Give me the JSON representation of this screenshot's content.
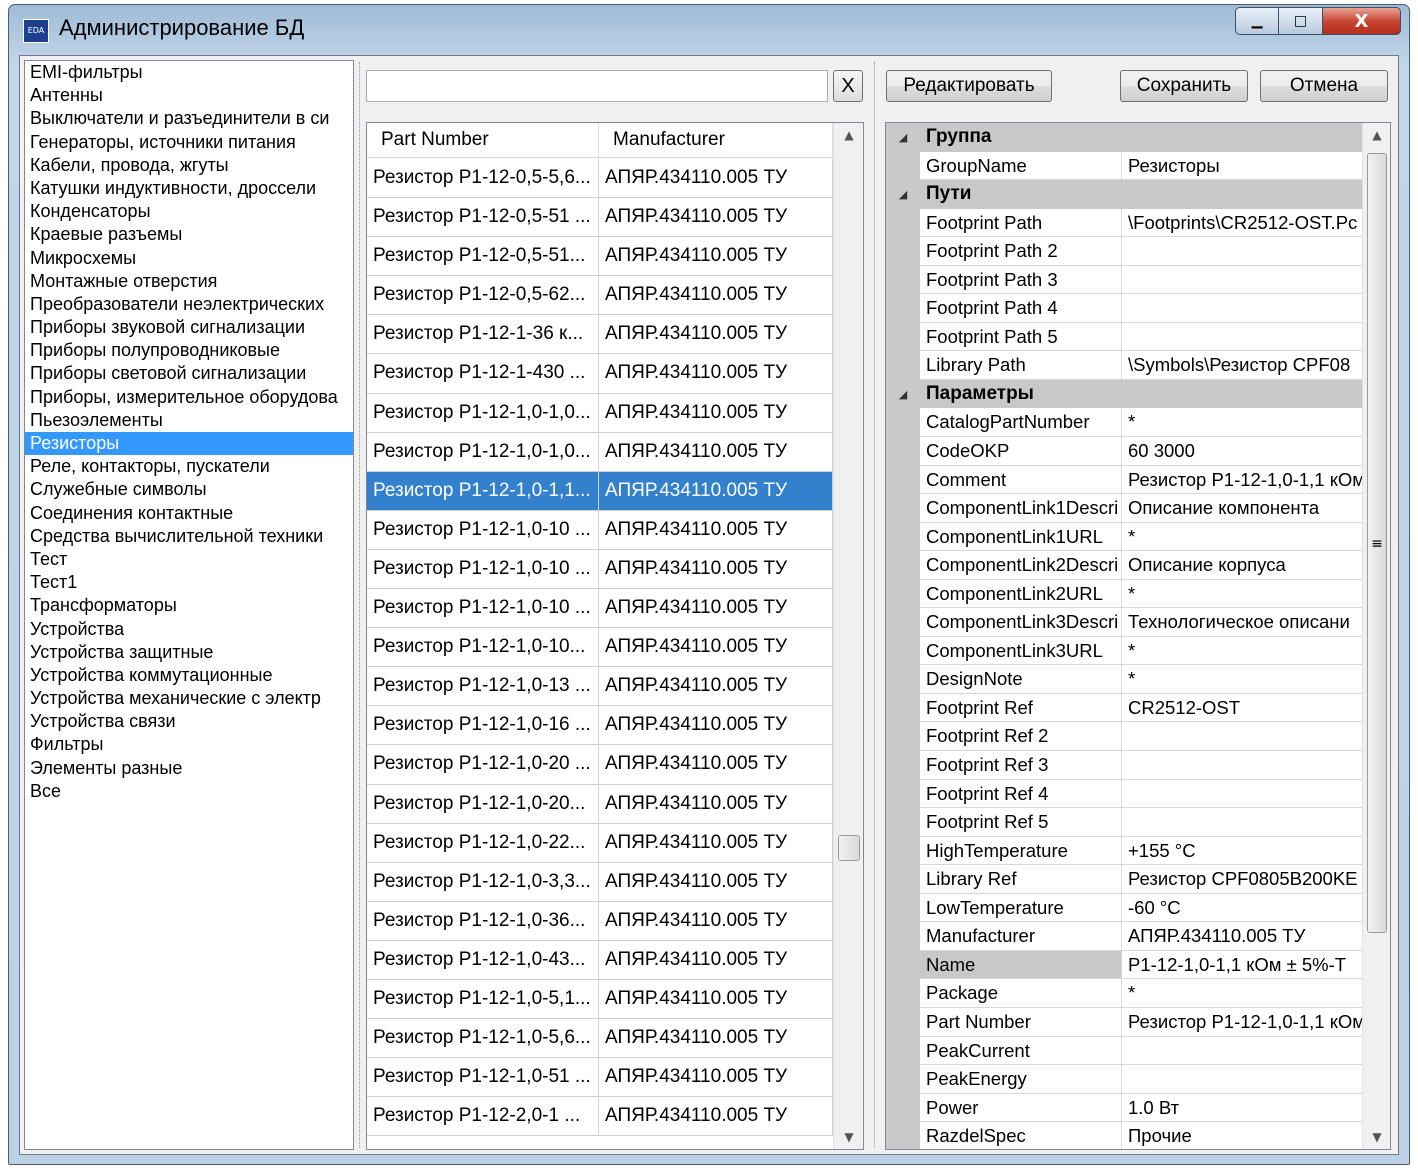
{
  "window": {
    "title": "Администрирование БД",
    "icon_label": "EDA",
    "minimize_glyph": "▁",
    "maximize_glyph": "□",
    "close_glyph": "X"
  },
  "categories": [
    "EMI-фильтры",
    "Антенны",
    "Выключатели и разъединители в си",
    "Генераторы, источники питания",
    "Кабели, провода, жгуты",
    "Катушки индуктивности, дроссели",
    "Конденсаторы",
    "Краевые разъемы",
    "Микросхемы",
    "Монтажные отверстия",
    "Преобразователи неэлектрических",
    "Приборы звуковой сигнализации",
    "Приборы полупроводниковые",
    "Приборы световой сигнализации",
    "Приборы, измерительное оборудова",
    "Пьезоэлементы",
    "Резисторы",
    "Реле, контакторы, пускатели",
    "Служебные символы",
    "Соединения контактные",
    "Средства вычислительной техники",
    "Тест",
    "Тест1",
    "Трансформаторы",
    "Устройства",
    "Устройства защитные",
    "Устройства коммутационные",
    "Устройства механические с электр",
    "Устройства связи",
    "Фильтры",
    "Элементы разные",
    "Все"
  ],
  "selected_category": "Резисторы",
  "search": {
    "value": "",
    "clear_label": "X"
  },
  "grid": {
    "columns": [
      "Part Number",
      "Manufacturer"
    ],
    "rows": [
      [
        "Резистор Р1-12-0,5-5,6...",
        "АПЯР.434110.005 ТУ"
      ],
      [
        "Резистор Р1-12-0,5-51 ...",
        "АПЯР.434110.005 ТУ"
      ],
      [
        "Резистор Р1-12-0,5-51...",
        "АПЯР.434110.005 ТУ"
      ],
      [
        "Резистор Р1-12-0,5-62...",
        "АПЯР.434110.005 ТУ"
      ],
      [
        "Резистор Р1-12-1-36 к...",
        "АПЯР.434110.005 ТУ"
      ],
      [
        "Резистор Р1-12-1-430 ...",
        "АПЯР.434110.005 ТУ"
      ],
      [
        "Резистор Р1-12-1,0-1,0...",
        "АПЯР.434110.005 ТУ"
      ],
      [
        "Резистор Р1-12-1,0-1,0...",
        "АПЯР.434110.005 ТУ"
      ],
      [
        "Резистор Р1-12-1,0-1,1...",
        "АПЯР.434110.005 ТУ"
      ],
      [
        "Резистор Р1-12-1,0-10 ...",
        "АПЯР.434110.005 ТУ"
      ],
      [
        "Резистор Р1-12-1,0-10 ...",
        "АПЯР.434110.005 ТУ"
      ],
      [
        "Резистор Р1-12-1,0-10 ...",
        "АПЯР.434110.005 ТУ"
      ],
      [
        "Резистор Р1-12-1,0-10...",
        "АПЯР.434110.005 ТУ"
      ],
      [
        "Резистор Р1-12-1,0-13 ...",
        "АПЯР.434110.005 ТУ"
      ],
      [
        "Резистор Р1-12-1,0-16 ...",
        "АПЯР.434110.005 ТУ"
      ],
      [
        "Резистор Р1-12-1,0-20 ...",
        "АПЯР.434110.005 ТУ"
      ],
      [
        "Резистор Р1-12-1,0-20...",
        "АПЯР.434110.005 ТУ"
      ],
      [
        "Резистор Р1-12-1,0-22...",
        "АПЯР.434110.005 ТУ"
      ],
      [
        "Резистор Р1-12-1,0-3,3...",
        "АПЯР.434110.005 ТУ"
      ],
      [
        "Резистор Р1-12-1,0-36...",
        "АПЯР.434110.005 ТУ"
      ],
      [
        "Резистор Р1-12-1,0-43...",
        "АПЯР.434110.005 ТУ"
      ],
      [
        "Резистор Р1-12-1,0-5,1...",
        "АПЯР.434110.005 ТУ"
      ],
      [
        "Резистор Р1-12-1,0-5,6...",
        "АПЯР.434110.005 ТУ"
      ],
      [
        "Резистор Р1-12-1,0-51 ...",
        "АПЯР.434110.005 ТУ"
      ],
      [
        "Резистор Р1-12-2,0-1 ...",
        "АПЯР.434110.005 ТУ"
      ]
    ],
    "selected_row": 8,
    "scroll_up": "▲",
    "scroll_down": "▼"
  },
  "buttons": {
    "edit": "Редактировать",
    "save": "Сохранить",
    "cancel": "Отмена"
  },
  "properties": {
    "collapse_glyph": "◢",
    "scroll_up": "▲",
    "scroll_down": "▼",
    "thumb_grip": "≡",
    "rows": [
      {
        "type": "category",
        "name": "Группа"
      },
      {
        "type": "prop",
        "name": "GroupName",
        "value": "Резисторы"
      },
      {
        "type": "category",
        "name": "Пути"
      },
      {
        "type": "prop",
        "name": "Footprint Path",
        "value": "\\Footprints\\CR2512-OST.Pc"
      },
      {
        "type": "prop",
        "name": "Footprint Path 2",
        "value": ""
      },
      {
        "type": "prop",
        "name": "Footprint Path 3",
        "value": ""
      },
      {
        "type": "prop",
        "name": "Footprint Path 4",
        "value": ""
      },
      {
        "type": "prop",
        "name": "Footprint Path 5",
        "value": ""
      },
      {
        "type": "prop",
        "name": "Library Path",
        "value": "\\Symbols\\Резистор CPF08"
      },
      {
        "type": "category",
        "name": "Параметры"
      },
      {
        "type": "prop",
        "name": "CatalogPartNumber",
        "value": "*"
      },
      {
        "type": "prop",
        "name": "CodeOKP",
        "value": "60 3000"
      },
      {
        "type": "prop",
        "name": "Comment",
        "value": "Резистор Р1-12-1,0-1,1 кОм"
      },
      {
        "type": "prop",
        "name": "ComponentLink1Descri",
        "value": "Описание компонента"
      },
      {
        "type": "prop",
        "name": "ComponentLink1URL",
        "value": "*"
      },
      {
        "type": "prop",
        "name": "ComponentLink2Descri",
        "value": "Описание корпуса"
      },
      {
        "type": "prop",
        "name": "ComponentLink2URL",
        "value": "*"
      },
      {
        "type": "prop",
        "name": "ComponentLink3Descri",
        "value": "Технологическое описани"
      },
      {
        "type": "prop",
        "name": "ComponentLink3URL",
        "value": "*"
      },
      {
        "type": "prop",
        "name": "DesignNote",
        "value": "*"
      },
      {
        "type": "prop",
        "name": "Footprint Ref",
        "value": "CR2512-OST"
      },
      {
        "type": "prop",
        "name": "Footprint Ref 2",
        "value": ""
      },
      {
        "type": "prop",
        "name": "Footprint Ref 3",
        "value": ""
      },
      {
        "type": "prop",
        "name": "Footprint Ref 4",
        "value": ""
      },
      {
        "type": "prop",
        "name": "Footprint Ref 5",
        "value": ""
      },
      {
        "type": "prop",
        "name": "HighTemperature",
        "value": "+155 °C"
      },
      {
        "type": "prop",
        "name": "Library Ref",
        "value": "Резистор CPF0805B200KE"
      },
      {
        "type": "prop",
        "name": "LowTemperature",
        "value": "-60 °C"
      },
      {
        "type": "prop",
        "name": "Manufacturer",
        "value": "АПЯР.434110.005 ТУ"
      },
      {
        "type": "prop",
        "name": "Name",
        "value": "Р1-12-1,0-1,1 кОм ± 5%-Т",
        "highlighted": true
      },
      {
        "type": "prop",
        "name": "Package",
        "value": "*"
      },
      {
        "type": "prop",
        "name": "Part Number",
        "value": "Резистор Р1-12-1,0-1,1 кОм"
      },
      {
        "type": "prop",
        "name": "PeakCurrent",
        "value": ""
      },
      {
        "type": "prop",
        "name": "PeakEnergy",
        "value": ""
      },
      {
        "type": "prop",
        "name": "Power",
        "value": "1.0 Вт"
      },
      {
        "type": "prop",
        "name": "RazdelSpec",
        "value": "Прочие"
      }
    ]
  }
}
